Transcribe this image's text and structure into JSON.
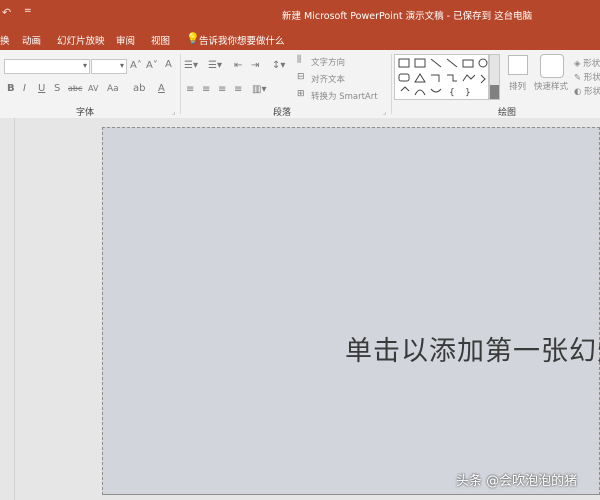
{
  "window": {
    "title": "新建 Microsoft PowerPoint 演示文稿 - 已保存到 这台电脑",
    "qat_icon": "undo-icon",
    "qat_more": "="
  },
  "tabs": [
    {
      "label": "换"
    },
    {
      "label": "动画"
    },
    {
      "label": "幻灯片放映"
    },
    {
      "label": "审阅"
    },
    {
      "label": "视图"
    }
  ],
  "tellme": {
    "text": "告诉我你想要做什么",
    "icon": "lightbulb-icon"
  },
  "ribbon": {
    "font_group": {
      "label": "字体",
      "font_name_value": "",
      "font_size_value": "",
      "increase_font": "A˄",
      "decrease_font": "A˅",
      "clear_format": "A",
      "bold": "B",
      "italic": "I",
      "underline": "U",
      "strike": "S",
      "abc": "abc",
      "spacing": "AV",
      "case": "Aa",
      "highlight": "ab",
      "font_color": "A"
    },
    "paragraph_group": {
      "label": "段落",
      "text_direction": "文字方向",
      "align_text": "对齐文本",
      "convert_smartart": "转换为 SmartArt"
    },
    "drawing_group": {
      "label": "绘图",
      "arrange": "排列",
      "quick_styles": "快速样式",
      "shape_fill": "形状",
      "shape_outline": "形状",
      "shape_effects": "形状"
    }
  },
  "slide": {
    "title_placeholder": "单击以添加第一张幻灯"
  },
  "watermark": "头条 @会吹泡泡的猪",
  "colors": {
    "accent": "#b7472a",
    "ribbon_bg": "#f3f3f3",
    "slide_bg": "#d2d5dc"
  }
}
